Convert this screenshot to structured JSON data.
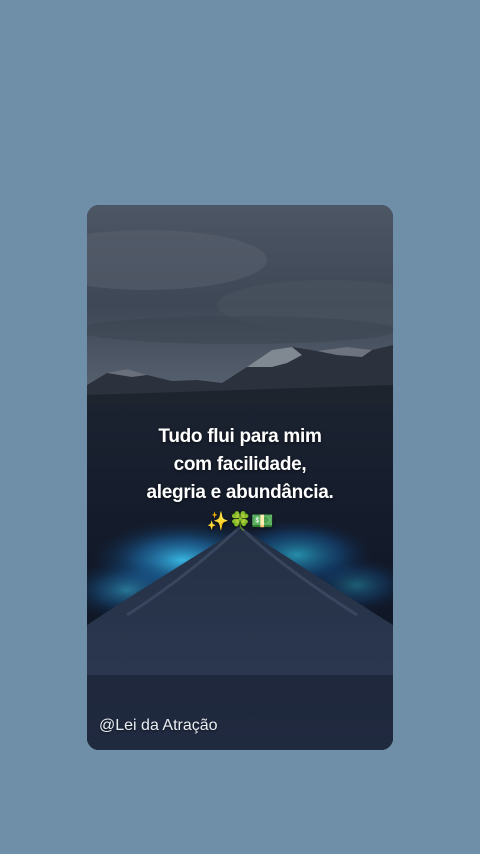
{
  "post": {
    "quote_lines": [
      "Tudo flui para mim",
      "com facilidade,",
      "alegria e abundância."
    ],
    "emojis": "✨🍀💵",
    "watermark": "@Lei da Atração"
  },
  "colors": {
    "page_background": "#6f8ea7",
    "text": "#ffffff",
    "glow": "#2aa8d8"
  }
}
